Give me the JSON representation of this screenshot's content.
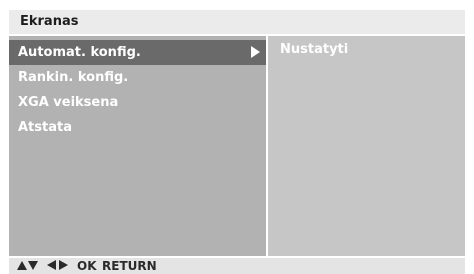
{
  "header": {
    "title": "Ekranas"
  },
  "menu": {
    "items": [
      {
        "label": "Automat. konfig.",
        "selected": true,
        "has_submenu": true
      },
      {
        "label": "Rankin. konfig.",
        "selected": false,
        "has_submenu": false
      },
      {
        "label": "XGA veiksena",
        "selected": false,
        "has_submenu": false
      },
      {
        "label": "Atstata",
        "selected": false,
        "has_submenu": false
      }
    ]
  },
  "submenu": {
    "value": "Nustatyti"
  },
  "footer": {
    "icons": [
      "up-arrow-icon",
      "down-arrow-icon",
      "left-arrow-icon",
      "right-arrow-icon"
    ],
    "ok_label": "OK",
    "return_label": "RETURN"
  },
  "colors": {
    "title_bg": "#ebebeb",
    "left_panel_bg": "#b2b2b2",
    "right_panel_bg": "#c6c6c6",
    "selected_bg": "#6a6a6a",
    "nav_bg": "#e4e4e4"
  }
}
